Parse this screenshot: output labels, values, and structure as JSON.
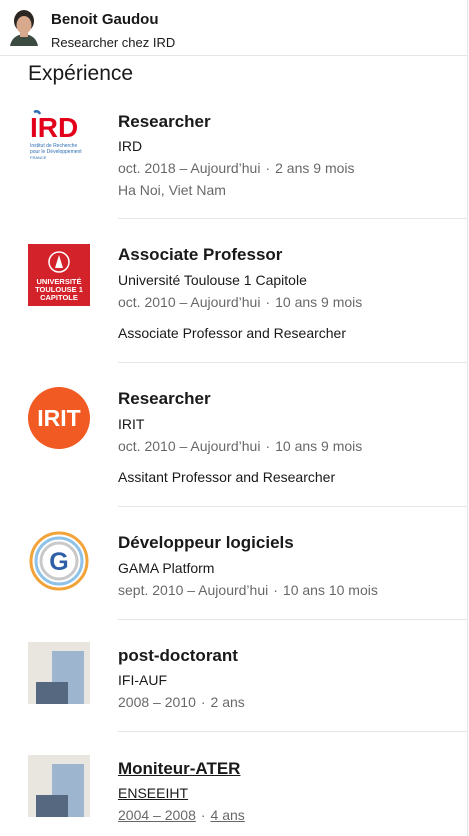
{
  "profile": {
    "name": "Benoit Gaudou",
    "headline": "Researcher chez IRD"
  },
  "section": {
    "title": "Expérience"
  },
  "experiences": [
    {
      "title": "Researcher",
      "company": "IRD",
      "dates": "oct. 2018 – Aujourd’hui",
      "duration": "2 ans 9 mois",
      "location": "Ha Noi, Viet Nam",
      "logo": "ird-logo",
      "logo_text": {
        "main": "IRD",
        "sub1": "Institut de Recherche",
        "sub2": "pour le Développement",
        "sub3": "FRANCE"
      }
    },
    {
      "title": "Associate Professor",
      "company": "Université Toulouse 1 Capitole",
      "dates": "oct. 2010 – Aujourd’hui",
      "duration": "10 ans 9 mois",
      "description": "Associate Professor and Researcher",
      "logo": "ut1-capitole-logo",
      "logo_text": {
        "l1": "UNIVERSITÉ",
        "l2": "TOULOUSE 1",
        "l3": "CAPITOLE"
      }
    },
    {
      "title": "Researcher",
      "company": "IRIT",
      "dates": "oct. 2010 – Aujourd’hui",
      "duration": "10 ans 9 mois",
      "description": "Assitant Professor and Researcher",
      "logo": "irit-logo",
      "logo_text": {
        "main": "IRIT"
      }
    },
    {
      "title": "Développeur logiciels",
      "company": "GAMA Platform",
      "dates": "sept. 2010 – Aujourd’hui",
      "duration": "10 ans 10 mois",
      "logo": "gama-logo",
      "logo_text": {
        "main": "G"
      }
    },
    {
      "title": "post-doctorant",
      "company": "IFI-AUF",
      "dates": "2008 – 2010",
      "duration": "2 ans",
      "logo": "placeholder-company-icon"
    },
    {
      "title": "Moniteur-ATER",
      "company": "ENSEEIHT",
      "dates": "2004 – 2008",
      "duration": "4 ans",
      "logo": "placeholder-company-icon"
    }
  ],
  "colors": {
    "ird_red": "#e2001a",
    "ird_blue": "#2e6db4",
    "ut1_red": "#d4222a",
    "irit_orange": "#f15a22",
    "placeholder_bg": "#e9e5df",
    "placeholder_light": "#9db5cf",
    "placeholder_dark": "#56687f"
  }
}
